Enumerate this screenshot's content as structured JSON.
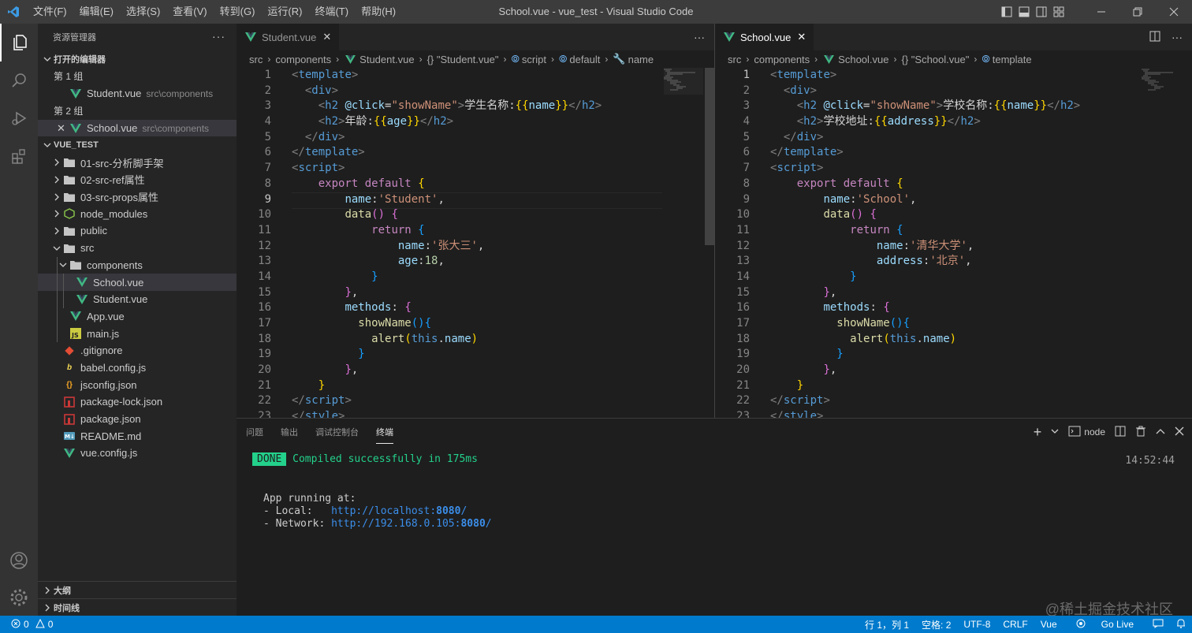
{
  "window": {
    "title": "School.vue - vue_test - Visual Studio Code",
    "menu": [
      "文件(F)",
      "编辑(E)",
      "选择(S)",
      "查看(V)",
      "转到(G)",
      "运行(R)",
      "终端(T)",
      "帮助(H)"
    ]
  },
  "sidebar": {
    "header": "资源管理器",
    "open_editors_title": "打开的编辑器",
    "group1_label": "第 1 组",
    "group1_file": "Student.vue",
    "group1_path": "src\\components",
    "group2_label": "第 2 组",
    "group2_file": "School.vue",
    "group2_path": "src\\components",
    "project_title": "VUE_TEST",
    "tree": [
      {
        "label": "01-src-分析脚手架",
        "type": "folder"
      },
      {
        "label": "02-src-ref属性",
        "type": "folder"
      },
      {
        "label": "03-src-props属性",
        "type": "folder"
      },
      {
        "label": "node_modules",
        "type": "folder-node"
      },
      {
        "label": "public",
        "type": "folder"
      },
      {
        "label": "src",
        "type": "folder-open"
      },
      {
        "label": "components",
        "type": "folder-open"
      },
      {
        "label": "School.vue",
        "type": "vue"
      },
      {
        "label": "Student.vue",
        "type": "vue"
      },
      {
        "label": "App.vue",
        "type": "vue"
      },
      {
        "label": "main.js",
        "type": "js"
      },
      {
        "label": ".gitignore",
        "type": "git"
      },
      {
        "label": "babel.config.js",
        "type": "babel"
      },
      {
        "label": "jsconfig.json",
        "type": "json"
      },
      {
        "label": "package-lock.json",
        "type": "npm"
      },
      {
        "label": "package.json",
        "type": "npm"
      },
      {
        "label": "README.md",
        "type": "md"
      },
      {
        "label": "vue.config.js",
        "type": "vue"
      }
    ],
    "outline_title": "大纲",
    "timeline_title": "时间线"
  },
  "editor_left": {
    "tab_label": "Student.vue",
    "breadcrumb": [
      "src",
      "components",
      "Student.vue",
      "{} \"Student.vue\"",
      "script",
      "default",
      "name"
    ],
    "line_numbers": [
      "1",
      "2",
      "3",
      "4",
      "5",
      "6",
      "7",
      "8",
      "9",
      "10",
      "11",
      "12",
      "13",
      "14",
      "15",
      "16",
      "17",
      "18",
      "19",
      "20",
      "21",
      "22",
      "23"
    ],
    "h2_text_1": "学生名称:",
    "h2_text_2": "年龄:",
    "name_expr": "name",
    "age_expr": "age",
    "component_name": "'Student'",
    "data_name_value": "'张大三'",
    "data_age_value": "18"
  },
  "editor_right": {
    "tab_label": "School.vue",
    "breadcrumb": [
      "src",
      "components",
      "School.vue",
      "{} \"School.vue\"",
      "template"
    ],
    "line_numbers": [
      "1",
      "2",
      "3",
      "4",
      "5",
      "6",
      "7",
      "8",
      "9",
      "10",
      "11",
      "12",
      "13",
      "14",
      "15",
      "16",
      "17",
      "18",
      "19",
      "20",
      "21",
      "22",
      "23"
    ],
    "h2_text_1": "学校名称:",
    "h2_text_2": "学校地址:",
    "name_expr": "name",
    "address_expr": "address",
    "component_name": "'School'",
    "data_name_value": "'清华大学'",
    "data_address_value": "'北京'"
  },
  "panel": {
    "tabs": [
      "问题",
      "输出",
      "调试控制台",
      "终端"
    ],
    "active_tab": "终端",
    "terminal_name": "node",
    "timestamp": "14:52:44",
    "done_badge": "DONE",
    "compiled_msg": "Compiled successfully in 175ms",
    "app_running": "App running at:",
    "local_label": "- Local:   ",
    "local_url": "http://localhost:",
    "local_port": "8080",
    "network_label": "- Network: ",
    "network_url": "http://192.168.0.105:",
    "network_port": "8080",
    "watermark": "@稀土掘金技术社区"
  },
  "statusbar": {
    "errors": "0",
    "warnings": "0",
    "position": "行 1，列 1",
    "spaces": "空格: 2",
    "encoding": "UTF-8",
    "eol": "CRLF",
    "language": "Vue",
    "golive": "Go Live"
  },
  "colors": {
    "accent": "#007acc",
    "vue_green": "#41b883"
  }
}
